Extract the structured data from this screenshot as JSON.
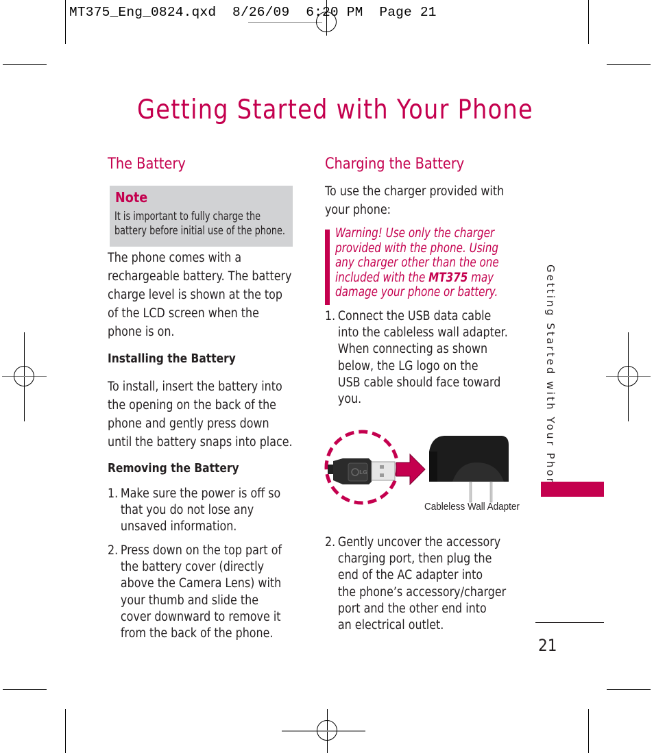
{
  "slug": {
    "filename": "MT375_Eng_0824.qxd",
    "date": "8/26/09",
    "time": "6:20 PM",
    "page_label": "Page 21"
  },
  "page_title": "Getting Started with Your Phone",
  "left_column": {
    "heading": "The Battery",
    "note": {
      "title": "Note",
      "lines": [
        "It is important to fully charge the",
        "battery before initial use of the phone."
      ]
    },
    "intro_lines": [
      "The phone comes with a",
      "rechargeable battery. The battery",
      "charge level is shown at the top",
      "of the LCD screen when the",
      "phone is on."
    ],
    "installing": {
      "heading": "Installing the Battery",
      "lines": [
        "To install, insert the battery into",
        "the opening on the back of the",
        "phone and gently press down",
        "until the battery snaps into place."
      ]
    },
    "removing": {
      "heading": "Removing the Battery",
      "steps": [
        {
          "num": "1.",
          "lines": [
            "Make sure the power is off so",
            "that you do not lose any",
            "unsaved information."
          ]
        },
        {
          "num": "2.",
          "lines": [
            "Press down on the top part of",
            "the battery cover (directly",
            "above the Camera Lens) with",
            "your thumb and slide the",
            "cover downward to remove it",
            "from the back of the phone."
          ]
        }
      ]
    }
  },
  "right_column": {
    "heading": "Charging the Battery",
    "intro_lines": [
      "To use the charger provided with",
      "your phone:"
    ],
    "warning": {
      "line1": "Warning! Use only the charger",
      "line2": "provided with the phone. Using",
      "line3": "any charger other than the one",
      "line4_pre": "included with the ",
      "line4_model": "MT375",
      "line4_post": " may",
      "line5": "damage your phone or battery."
    },
    "steps": [
      {
        "num": "1.",
        "lines": [
          "Connect the USB data cable",
          "into the cableless wall adapter.",
          "When connecting as shown",
          "below, the LG logo on the",
          "USB cable should face toward",
          "you."
        ]
      },
      {
        "num": "2.",
        "lines": [
          "Gently uncover the accessory",
          "charging port, then plug the",
          "end of the AC adapter into",
          "the phone’s accessory/charger",
          "port and the other end into",
          "an electrical outlet."
        ]
      }
    ],
    "figure": {
      "usb_logo": "LG",
      "caption": "Cableless Wall Adapter"
    }
  },
  "side_tab": {
    "label": "Getting Started with Your Phone"
  },
  "page_number": "21",
  "colors": {
    "accent": "#c4004e",
    "note_bg": "#d1d2d4",
    "text": "#231f20"
  }
}
